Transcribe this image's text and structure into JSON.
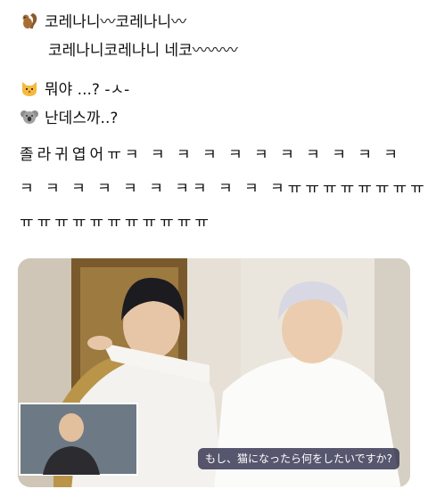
{
  "tweet": {
    "lines": [
      {
        "icon": "squirrel-icon",
        "text": "코레나니〰코레나니〰"
      },
      {
        "icon": "",
        "text": "코레나니코레나니 네코〰〰〰"
      },
      {
        "icon": "cat-icon",
        "text": "뭐야 ...? -ㅅ-"
      },
      {
        "icon": "koala-icon",
        "text": "난데스까..?"
      }
    ],
    "reaction_1": "졸라귀엽어ㅠㅋ ㅋ ㅋ ㅋ ㅋ ㅋ  ㅋ ㅋ ㅋ ㅋ ㅋ",
    "reaction_2": "ㅋ ㅋ ㅋ ㅋ  ㅋ ㅋ ㅋㅋ ㅋ ㅋ ㅋㅠㅠㅠㅠㅠㅠㅠㅠ",
    "reaction_3": "ㅠㅠㅠㅠㅠㅠㅠㅠㅠㅠㅠ"
  },
  "media": {
    "caption": "もし、猫になったら何をしたいですか?"
  }
}
